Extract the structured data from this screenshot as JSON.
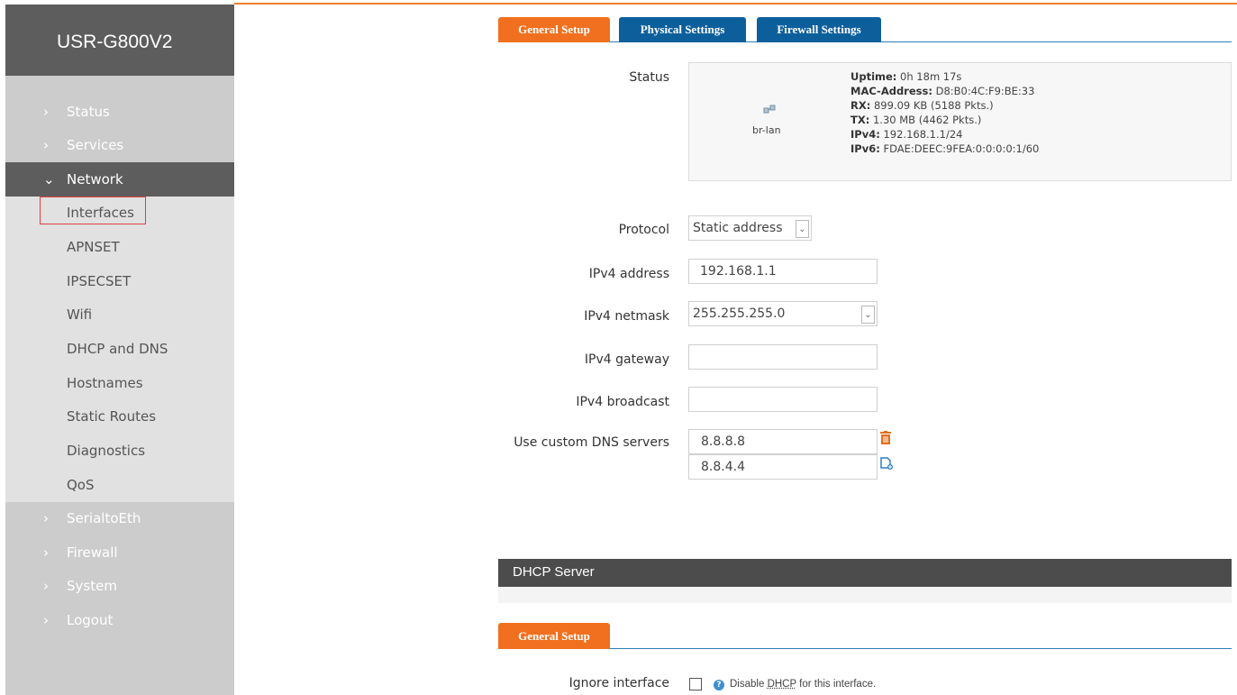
{
  "brand": "USR-G800V2",
  "sidebar": {
    "top_items": [
      {
        "label": "Status"
      },
      {
        "label": "Services"
      }
    ],
    "active_item": {
      "label": "Network"
    },
    "sub_items": [
      {
        "label": "Interfaces"
      },
      {
        "label": "APNSET"
      },
      {
        "label": "IPSECSET"
      },
      {
        "label": "Wifi"
      },
      {
        "label": "DHCP and DNS"
      },
      {
        "label": "Hostnames"
      },
      {
        "label": "Static Routes"
      },
      {
        "label": "Diagnostics"
      },
      {
        "label": "QoS"
      }
    ],
    "bottom_items": [
      {
        "label": "SerialtoEth"
      },
      {
        "label": "Firewall"
      },
      {
        "label": "System"
      },
      {
        "label": "Logout"
      }
    ]
  },
  "tabs": [
    {
      "label": "General Setup",
      "active": true
    },
    {
      "label": "Physical Settings",
      "active": false
    },
    {
      "label": "Firewall Settings",
      "active": false
    }
  ],
  "status": {
    "label": "Status",
    "iface": "br-lan",
    "uptime_key": "Uptime:",
    "uptime": "0h 18m 17s",
    "mac_key": "MAC-Address:",
    "mac": "D8:B0:4C:F9:BE:33",
    "rx_key": "RX:",
    "rx": "899.09 KB (5188 Pkts.)",
    "tx_key": "TX:",
    "tx": "1.30 MB (4462 Pkts.)",
    "ipv4_key": "IPv4:",
    "ipv4": "192.168.1.1/24",
    "ipv6_key": "IPv6:",
    "ipv6": "FDAE:DEEC:9FEA:0:0:0:0:1/60"
  },
  "form": {
    "protocol_label": "Protocol",
    "protocol_value": "Static address",
    "ipv4_address_label": "IPv4 address",
    "ipv4_address_value": "192.168.1.1",
    "ipv4_netmask_label": "IPv4 netmask",
    "ipv4_netmask_value": "255.255.255.0",
    "ipv4_gateway_label": "IPv4 gateway",
    "ipv4_gateway_value": "",
    "ipv4_broadcast_label": "IPv4 broadcast",
    "ipv4_broadcast_value": "",
    "dns_label": "Use custom DNS servers",
    "dns_1": "8.8.8.8",
    "dns_2": "8.8.4.4"
  },
  "dhcp": {
    "section_title": "DHCP Server",
    "tab_label": "General Setup",
    "ignore_label": "Ignore interface",
    "hint_prefix": "Disable ",
    "hint_abbr": "DHCP",
    "hint_suffix": " for this interface."
  },
  "colors": {
    "accent_orange": "#f0701f",
    "tab_blue": "#0d5f9c",
    "sidebar_dark": "#5d5d5d",
    "sidebar_gray": "#cccccc",
    "highlight_red": "#e04040"
  }
}
